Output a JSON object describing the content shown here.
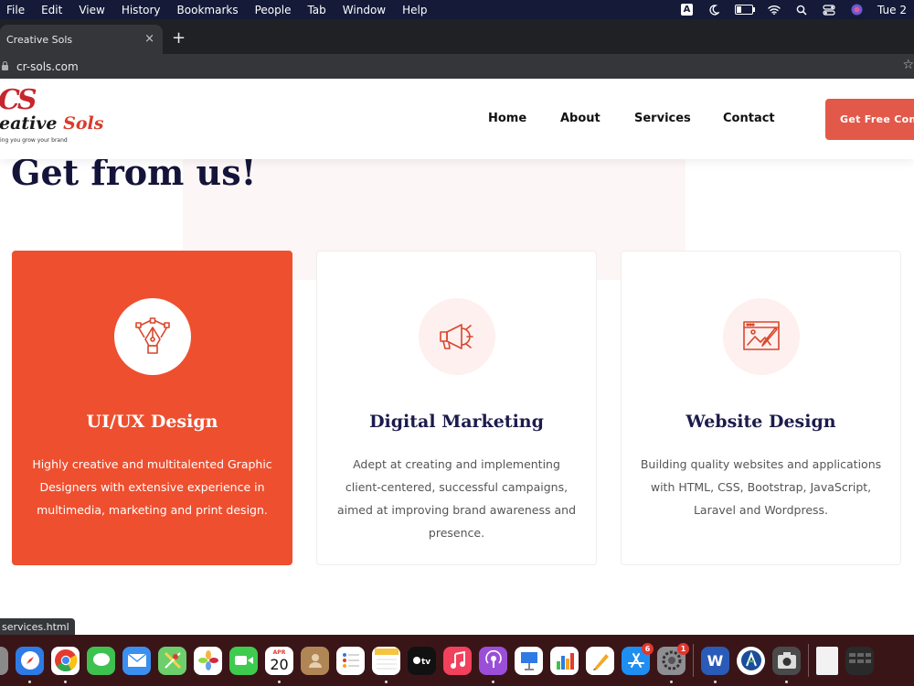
{
  "menubar": {
    "items": [
      "File",
      "Edit",
      "View",
      "History",
      "Bookmarks",
      "People",
      "Tab",
      "Window",
      "Help"
    ],
    "input_indicator": "A",
    "clock": "Tue 2"
  },
  "browser": {
    "tab_title": "Creative Sols",
    "close_glyph": "×",
    "new_tab_glyph": "+",
    "url": "cr-sols.com",
    "status_url": "services.html"
  },
  "site": {
    "logo": {
      "mark": "CS",
      "brand_part1": "eative",
      "brand_part2": "Sols",
      "tagline": "ing you grow your brand"
    },
    "nav": [
      "Home",
      "About",
      "Services",
      "Contact"
    ],
    "cta_label": "Get Free Con"
  },
  "section": {
    "heading": "Get from us!",
    "cards": [
      {
        "title": "UI/UX Design",
        "desc": "Highly creative and multitalented Graphic Designers with extensive experience in multimedia, marketing and print design.",
        "icon": "pen-tool-icon",
        "active": true
      },
      {
        "title": "Digital Marketing",
        "desc": "Adept at creating and implementing client-centered, successful campaigns, aimed at improving brand awareness and presence.",
        "icon": "megaphone-icon",
        "active": false
      },
      {
        "title": "Website Design",
        "desc": "Building quality websites and applications with HTML, CSS, Bootstrap, JavaScript, Laravel and Wordpress.",
        "icon": "web-design-icon",
        "active": false
      }
    ]
  },
  "dock": {
    "calendar_month": "APR",
    "calendar_day": "20",
    "appstore_badge": "6",
    "settings_badge": "1",
    "word_label": "W"
  },
  "colors": {
    "accent": "#ee4f2f",
    "cta": "#e2594a",
    "heading": "#14143a",
    "menubar": "#141a38"
  }
}
